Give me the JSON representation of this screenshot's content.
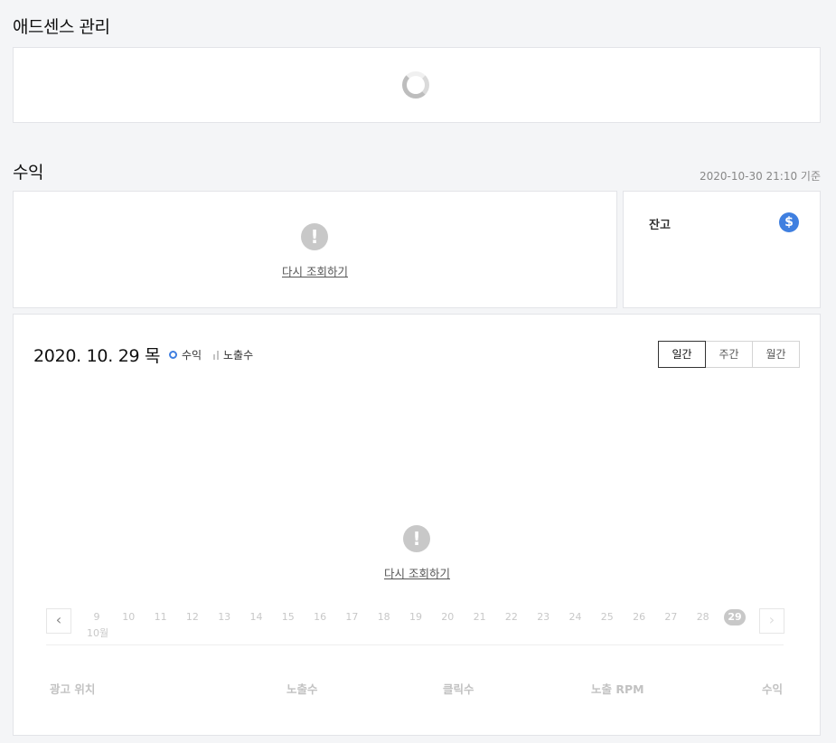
{
  "adsense": {
    "title": "애드센스 관리"
  },
  "revenue": {
    "title": "수익",
    "timestamp": "2020-10-30 21:10 기준",
    "error_card": {
      "retry_label": "다시 조회하기"
    },
    "balance": {
      "label": "잔고",
      "icon": "dollar-icon"
    }
  },
  "chart": {
    "date": "2020. 10. 29 목",
    "legend": {
      "revenue": "수익",
      "impressions": "노출수"
    },
    "toggles": [
      {
        "label": "일간",
        "active": true
      },
      {
        "label": "주간",
        "active": false
      },
      {
        "label": "월간",
        "active": false
      }
    ],
    "retry_label": "다시 조회하기",
    "prev_icon": "chevron-left-icon",
    "next_icon": "chevron-right-icon",
    "prev_glyph": "‹",
    "next_glyph": "›",
    "month_label": "10월",
    "dates": [
      "9",
      "10",
      "11",
      "12",
      "13",
      "14",
      "15",
      "16",
      "17",
      "18",
      "19",
      "20",
      "21",
      "22",
      "23",
      "24",
      "25",
      "26",
      "27",
      "28",
      "29"
    ],
    "selected_date": "29"
  },
  "table": {
    "headers": [
      "광고 위치",
      "노출수",
      "클릭수",
      "노출 RPM",
      "수익"
    ]
  },
  "colors": {
    "accent": "#3f7fe0",
    "muted": "#c8c8c8"
  }
}
